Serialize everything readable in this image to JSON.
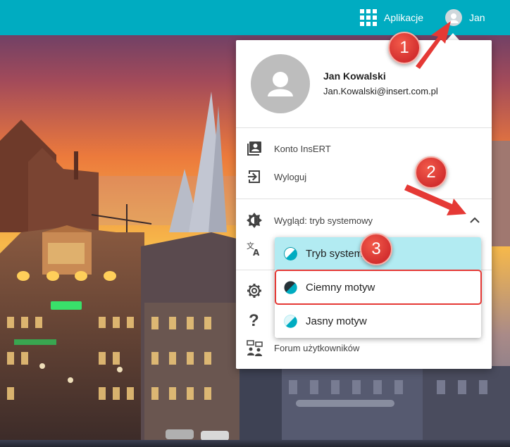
{
  "header": {
    "apps_label": "Aplikacje",
    "user_label": "Jan",
    "accent_color": "#00acc1"
  },
  "profile": {
    "name": "Jan Kowalski",
    "email": "Jan.Kowalski@insert.com.pl"
  },
  "menu": {
    "account": {
      "label": "Konto InsERT",
      "icon": "account-box-icon"
    },
    "logout": {
      "label": "Wyloguj",
      "icon": "logout-icon"
    },
    "appearance": {
      "label": "Wygląd: tryb systemowy",
      "icon": "brightness-icon",
      "expanded": true
    },
    "language": {
      "icon": "translate-icon"
    },
    "settings": {
      "icon": "gear-icon"
    },
    "help": {
      "icon": "help-icon"
    },
    "forum": {
      "label": "Forum użytkowników",
      "icon": "forum-users-icon"
    }
  },
  "theme_menu": {
    "options": [
      {
        "label": "Tryb systemowy",
        "icon": "theme-system-icon",
        "selected": true
      },
      {
        "label": "Ciemny motyw",
        "icon": "theme-dark-icon",
        "highlighted": true
      },
      {
        "label": "Jasny motyw",
        "icon": "theme-light-icon"
      }
    ]
  },
  "annotations": {
    "badge1": "1",
    "badge2": "2",
    "badge3": "3",
    "color": "#d32f2f"
  }
}
